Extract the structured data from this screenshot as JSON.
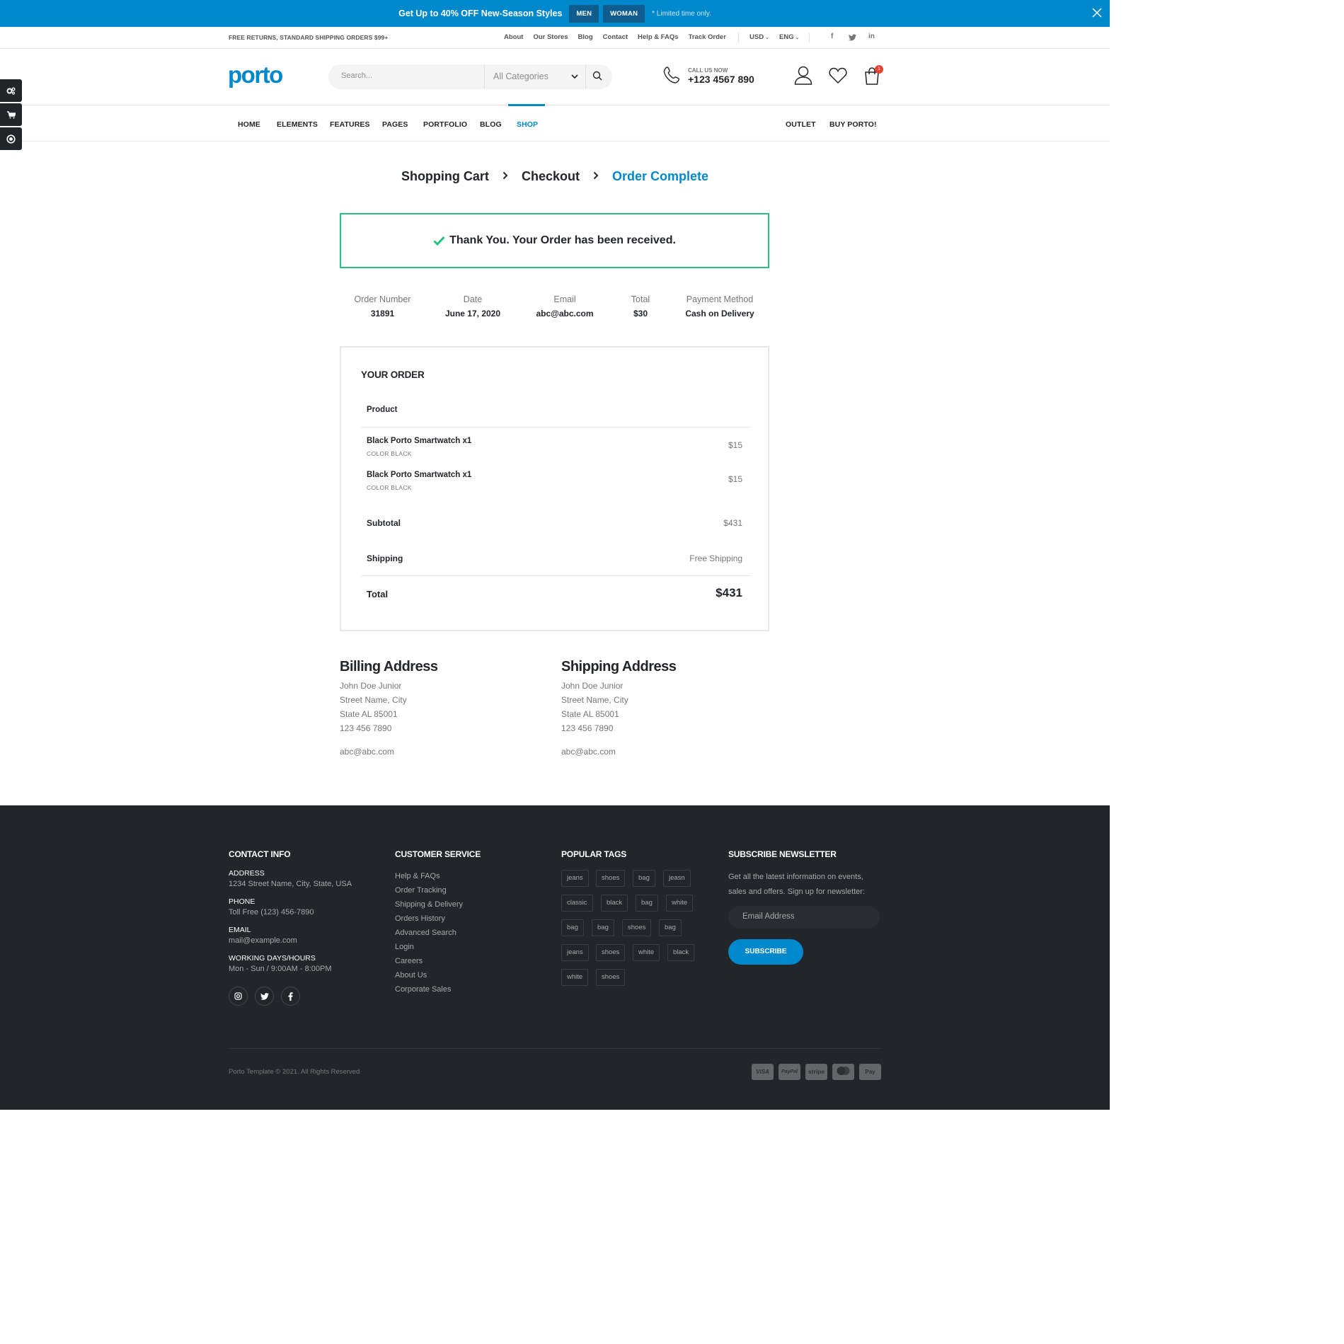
{
  "promo": {
    "text_pre": "Get Up to ",
    "text_bold": "40% OFF",
    "text_post": " New-Season Styles",
    "btn_men": "MEN",
    "btn_woman": "WOMAN",
    "limited": "* Limited time only."
  },
  "topbar": {
    "shipping_note": "FREE RETURNS, STANDARD SHIPPING ORDERS $99+",
    "links": [
      "About",
      "Our Stores",
      "Blog",
      "Contact",
      "Help & FAQs",
      "Track Order"
    ],
    "currency": "USD",
    "language": "ENG",
    "social": [
      "f",
      "t",
      "in"
    ]
  },
  "header": {
    "logo": "porto",
    "search_placeholder": "Search...",
    "category": "All Categories",
    "call_label": "CALL US NOW",
    "phone": "+123 4567 890",
    "cart_count": "1"
  },
  "nav": {
    "items": [
      "HOME",
      "ELEMENTS",
      "FEATURES",
      "PAGES",
      "PORTFOLIO",
      "BLOG",
      "SHOP"
    ],
    "right": [
      "OUTLET",
      "BUY PORTO!"
    ],
    "active": "SHOP"
  },
  "steps": [
    "Shopping Cart",
    "Checkout",
    "Order Complete"
  ],
  "thanks": "Thank You. Your Order has been received.",
  "order_info": [
    {
      "label": "Order Number",
      "value": "31891"
    },
    {
      "label": "Date",
      "value": "June 17, 2020"
    },
    {
      "label": "Email",
      "value": "abc@abc.com"
    },
    {
      "label": "Total",
      "value": "$30"
    },
    {
      "label": "Payment Method",
      "value": "Cash on Delivery"
    }
  ],
  "your_order": {
    "title": "YOUR ORDER",
    "product_header": "Product",
    "items": [
      {
        "name": "Black Porto Smartwatch x1",
        "variant": "COLOR BLACK",
        "price": "$15"
      },
      {
        "name": "Black Porto Smartwatch x1",
        "variant": "COLOR BLACK",
        "price": "$15"
      }
    ],
    "subtotal_label": "Subtotal",
    "subtotal": "$431",
    "shipping_label": "Shipping",
    "shipping": "Free Shipping",
    "total_label": "Total",
    "total": "$431"
  },
  "billing": {
    "title": "Billing Address",
    "lines": [
      "John Doe Junior",
      "Street Name, City",
      "State AL 85001",
      "123 456 7890"
    ],
    "email": "abc@abc.com"
  },
  "shipping_addr": {
    "title": "Shipping Address",
    "lines": [
      "John Doe Junior",
      "Street Name, City",
      "State AL 85001",
      "123 456 7890"
    ],
    "email": "abc@abc.com"
  },
  "footer": {
    "contact_title": "CONTACT INFO",
    "address_label": "ADDRESS",
    "address": "1234 Street Name, City, State, USA",
    "phone_label": "PHONE",
    "phone": "Toll Free (123) 456-7890",
    "email_label": "EMAIL",
    "email": "mail@example.com",
    "hours_label": "WORKING DAYS/HOURS",
    "hours": "Mon - Sun / 9:00AM - 8:00PM",
    "cs_title": "CUSTOMER SERVICE",
    "cs_links": [
      "Help & FAQs",
      "Order Tracking",
      "Shipping & Delivery",
      "Orders History",
      "Advanced Search",
      "Login",
      "Careers",
      "About Us",
      "Corporate Sales"
    ],
    "tags_title": "POPULAR TAGS",
    "tags": [
      [
        "jeans",
        "shoes",
        "bag",
        "jeasn"
      ],
      [
        "classic",
        "black",
        "bag",
        "white"
      ],
      [
        "bag",
        "bag",
        "shoes",
        "bag"
      ],
      [
        "jeans",
        "shoes",
        "white",
        "black"
      ],
      [
        "white",
        "shoes"
      ]
    ],
    "nl_title": "SUBSCRIBE NEWSLETTER",
    "nl_text": "Get all the latest information on events, sales and offers. Sign up for newsletter:",
    "nl_placeholder": "Email Address",
    "nl_button": "SUBSCRIBE",
    "copyright": "Porto Template © 2021. All Rights Reserved",
    "payments": [
      "VISA",
      "PayPal",
      "stripe",
      "mastercard",
      "Pay"
    ]
  },
  "colors": {
    "accent": "#0088cc",
    "success": "#26c281",
    "dark": "#222529",
    "badge": "#e84133"
  }
}
